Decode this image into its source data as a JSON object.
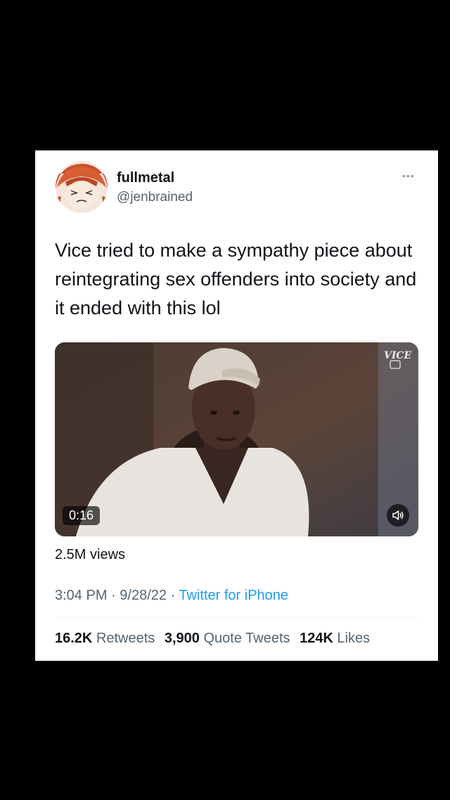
{
  "author": {
    "display_name": "fullmetal",
    "handle": "@jenbrained"
  },
  "tweet": {
    "text": "Vice tried to make a sympathy piece about reintegrating sex offenders into society and it ended with this lol"
  },
  "video": {
    "duration": "0:16",
    "watermark": "VICE",
    "views": "2.5M views"
  },
  "meta": {
    "time": "3:04 PM",
    "sep1": " · ",
    "date": "9/28/22",
    "sep2": " · ",
    "source": "Twitter for iPhone"
  },
  "stats": {
    "retweets_count": "16.2K",
    "retweets_label": "Retweets",
    "quotes_count": "3,900",
    "quotes_label": "Quote Tweets",
    "likes_count": "124K",
    "likes_label": "Likes"
  },
  "colors": {
    "link": "#1d9bf0",
    "secondary_text": "#536471",
    "primary_text": "#0f1419"
  }
}
